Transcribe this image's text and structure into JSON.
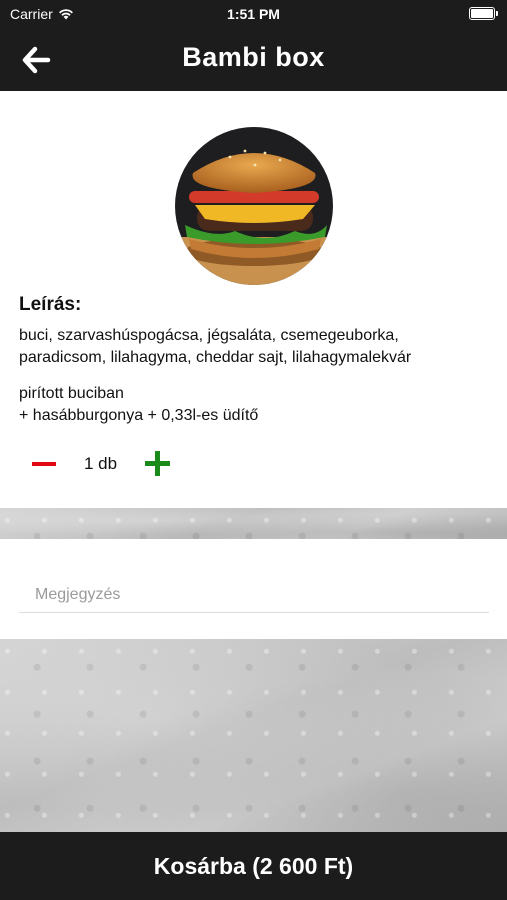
{
  "status_bar": {
    "carrier": "Carrier",
    "time": "1:51 PM",
    "wifi_icon": "wifi-icon",
    "battery_icon": "battery-icon"
  },
  "nav": {
    "title": "Bambi box",
    "back_icon": "arrow-left-icon"
  },
  "product": {
    "image_icon": "burger-image",
    "description_title": "Leírás:",
    "description": "buci, szarvashúspogácsa, jégsaláta, csemegeuborka, paradicsom, lilahagyma, cheddar sajt, lilahagymalekvár",
    "extra": "pirított buciban\n+ hasábburgonya + 0,33l-es üdítő"
  },
  "quantity": {
    "count_label": "1 db",
    "minus_icon": "minus-icon",
    "plus_icon": "plus-icon",
    "minus_color": "#e30613",
    "plus_color": "#1a8a1a"
  },
  "notes": {
    "placeholder": "Megjegyzés",
    "value": ""
  },
  "cart_button": {
    "label": "Kosárba (2 600 Ft)"
  },
  "colors": {
    "bar_background": "#1c1c1c",
    "content_background": "#ffffff"
  }
}
